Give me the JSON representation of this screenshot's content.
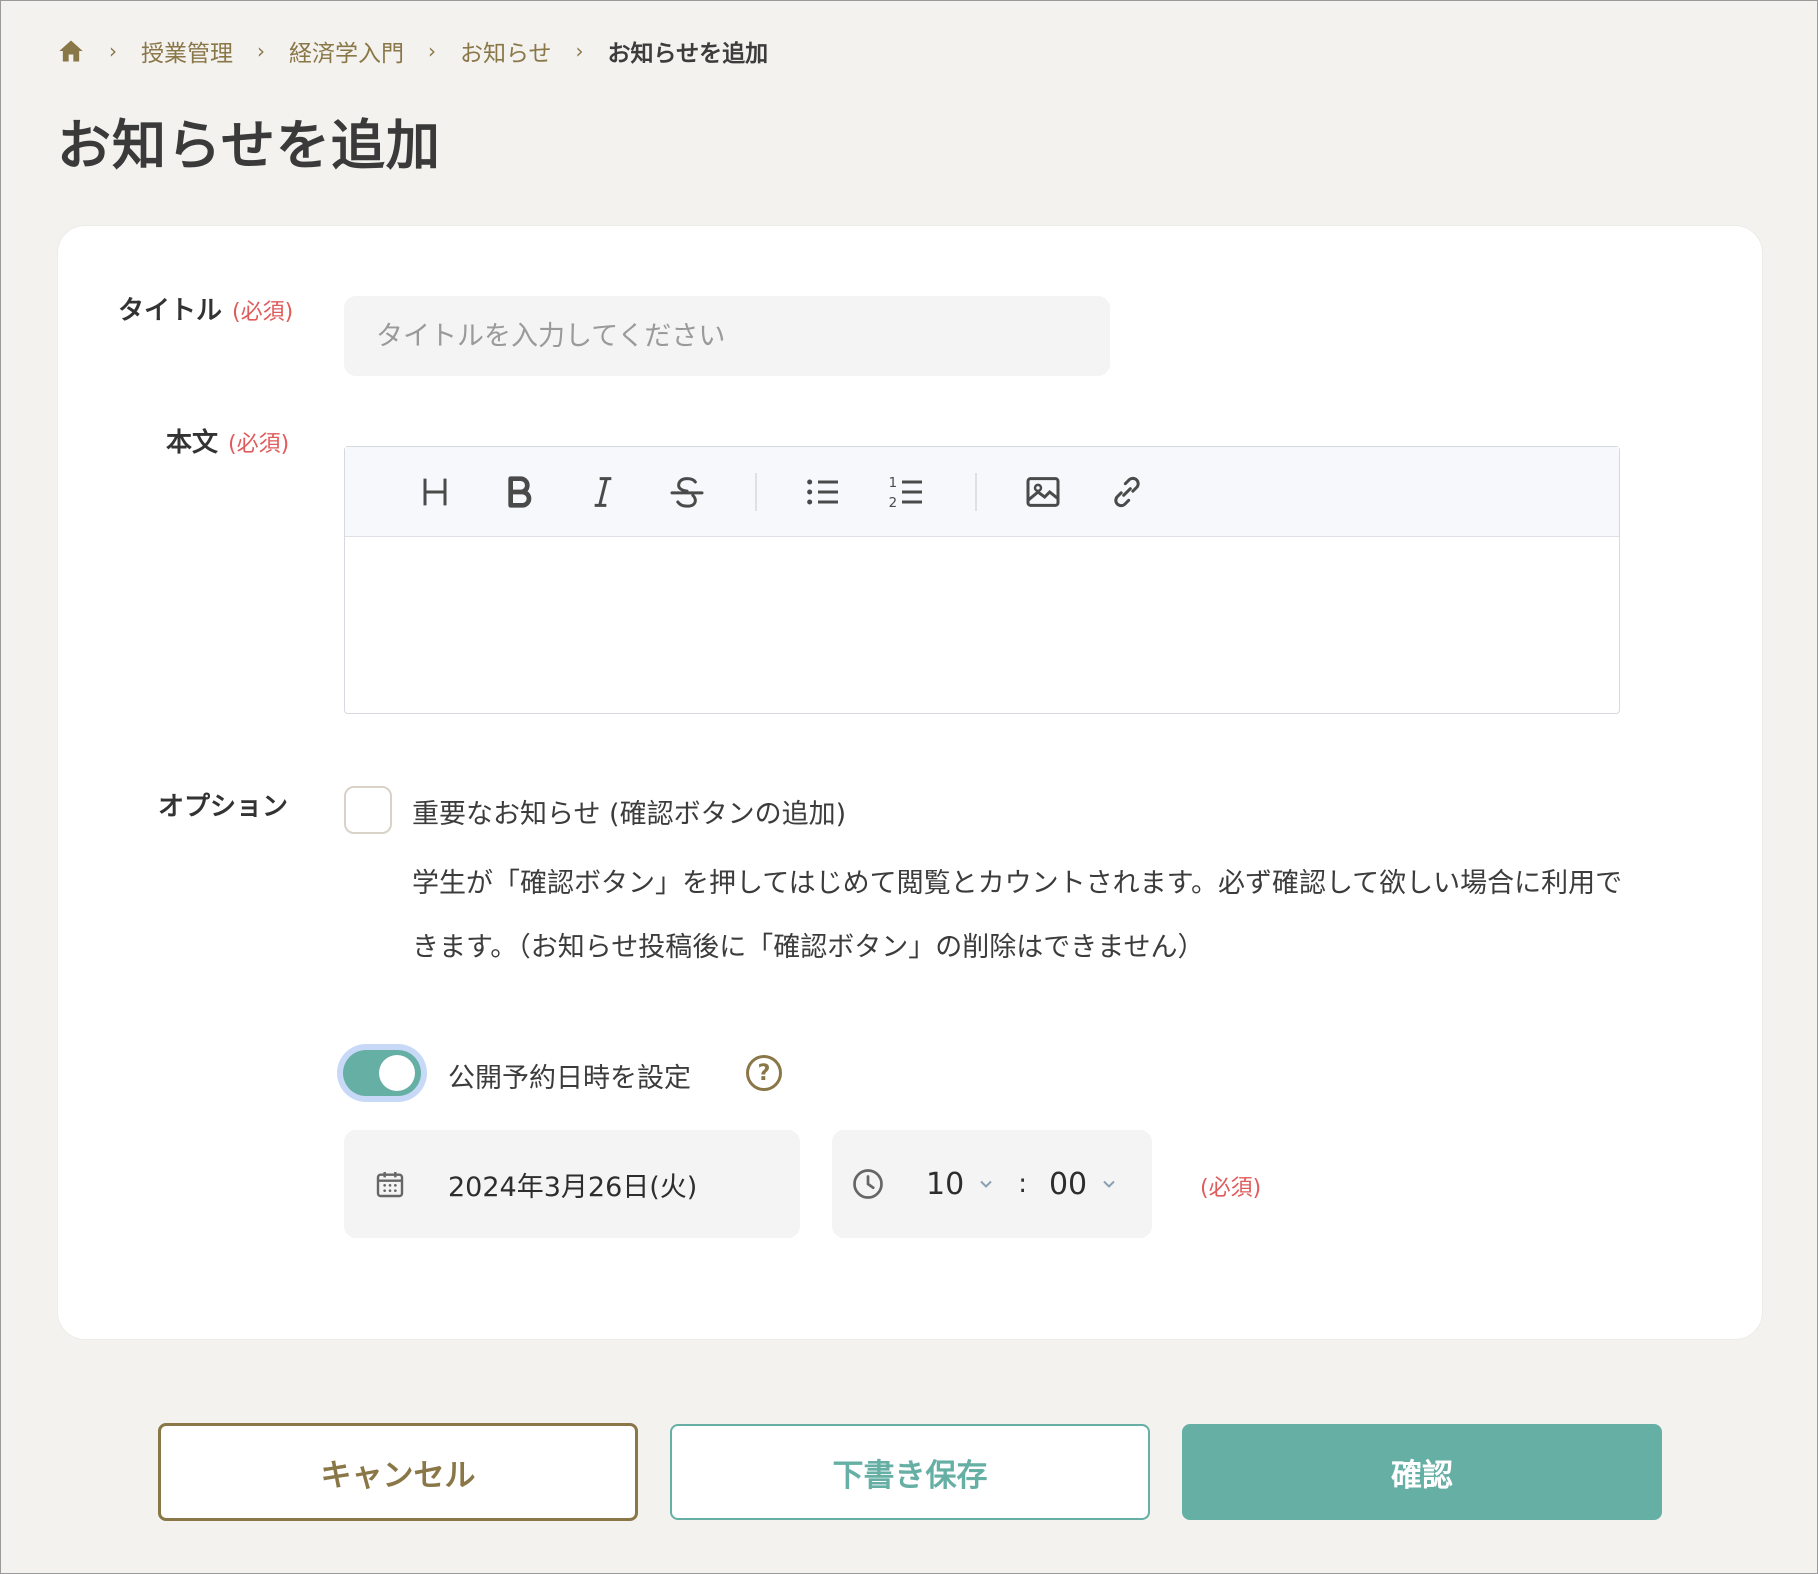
{
  "breadcrumb": {
    "home_icon": "home-icon",
    "items": [
      "授業管理",
      "経済学入門",
      "お知らせ"
    ],
    "current": "お知らせを追加"
  },
  "page": {
    "title": "お知らせを追加"
  },
  "form": {
    "required_mark": "(必須)",
    "title_label": "タイトル",
    "title_placeholder": "タイトルを入力してください",
    "body_label": "本文",
    "toolbar": [
      "heading",
      "bold",
      "italic",
      "strikethrough",
      "bullet-list",
      "numbered-list",
      "image",
      "link"
    ],
    "options_label": "オプション",
    "important_checked": false,
    "important_label": "重要なお知らせ (確認ボタンの追加)",
    "important_desc": "学生が「確認ボタン」を押してはじめて閲覧とカウントされます。必ず確認して欲しい場合に利用できます。（お知らせ投稿後に「確認ボタン」の削除はできません）",
    "schedule_enabled": true,
    "schedule_label": "公開予約日時を設定",
    "help_glyph": "?",
    "date": "2024年3月26日(火)",
    "hour": "10",
    "minute": "00",
    "time_separator": ":"
  },
  "actions": {
    "cancel": "キャンセル",
    "draft": "下書き保存",
    "confirm": "確認"
  },
  "colors": {
    "accent": "#66afa5",
    "brown": "#8a7748",
    "required": "#e05b5b"
  }
}
